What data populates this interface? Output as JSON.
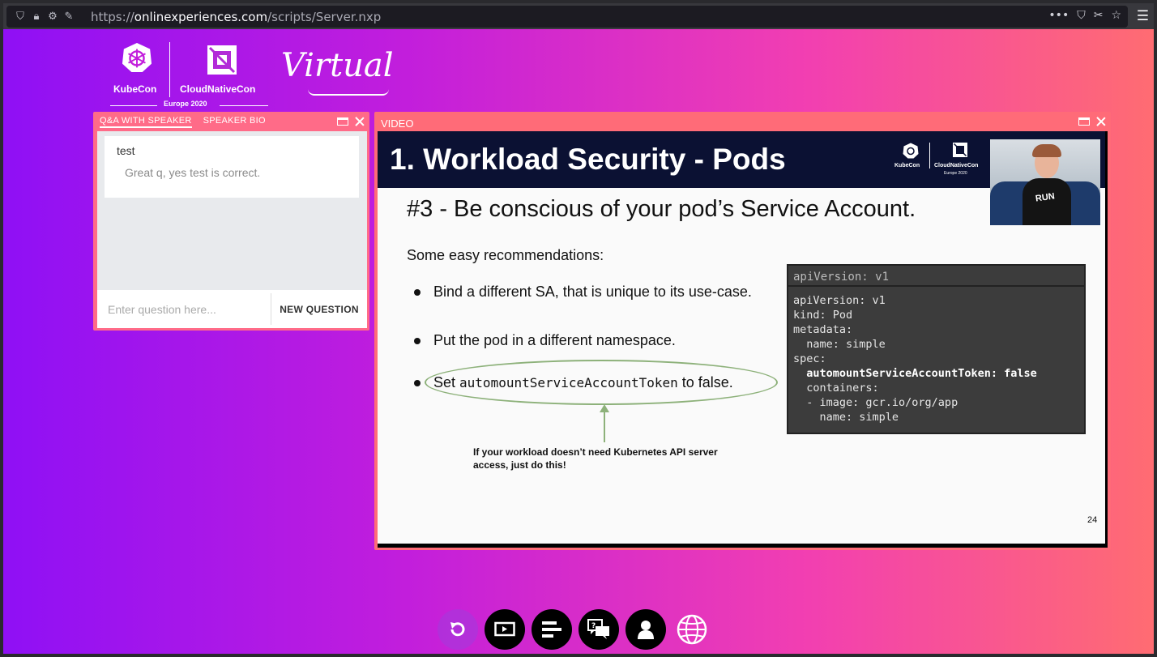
{
  "browser": {
    "url_scheme": "https://",
    "url_host": "onlinexperiences.com",
    "url_path": "/scripts/Server.nxp"
  },
  "branding": {
    "kubecon": "KubeCon",
    "cloudnativecon": "CloudNativeCon",
    "europe": "Europe 2020",
    "virtual": "Virtual"
  },
  "qa_panel": {
    "tabs": [
      "Q&A WITH SPEAKER",
      "SPEAKER BIO"
    ],
    "question": "test",
    "answer": "Great q, yes test is correct.",
    "input_placeholder": "Enter question here...",
    "new_question_label": "NEW QUESTION"
  },
  "video_panel": {
    "title": "VIDEO",
    "slide": {
      "title": "1. Workload Security - Pods",
      "logo_kubecon": "KubeCon",
      "logo_cncf": "CloudNativeCon",
      "logo_europe": "Europe 2020",
      "shirt_text": "RUN",
      "subtitle": "#3 - Be conscious of your pod’s Service Account.",
      "recommendations_heading": "Some easy recommendations:",
      "bullet_1": "Bind a different SA, that is unique to its use-case.",
      "bullet_2": "Put the pod in a different namespace.",
      "bullet_3_prefix": "Set ",
      "bullet_3_code": "automountServiceAccountToken",
      "bullet_3_suffix": " to false.",
      "note": "If your workload doesn’t need Kubernetes API server access, just do this!",
      "code_header": "apiVersion: v1",
      "code_lines": [
        "apiVersion: v1",
        "kind: Pod",
        "metadata:",
        "  name: simple",
        "spec:",
        "  automountServiceAccountToken: false",
        "  containers:",
        "  - image: gcr.io/org/app",
        "    name: simple"
      ],
      "page_number": "24"
    }
  },
  "toolbar": {
    "buttons": [
      "refresh-icon",
      "screen-icon",
      "agenda-icon",
      "chat-icon",
      "person-icon",
      "globe-icon"
    ]
  }
}
